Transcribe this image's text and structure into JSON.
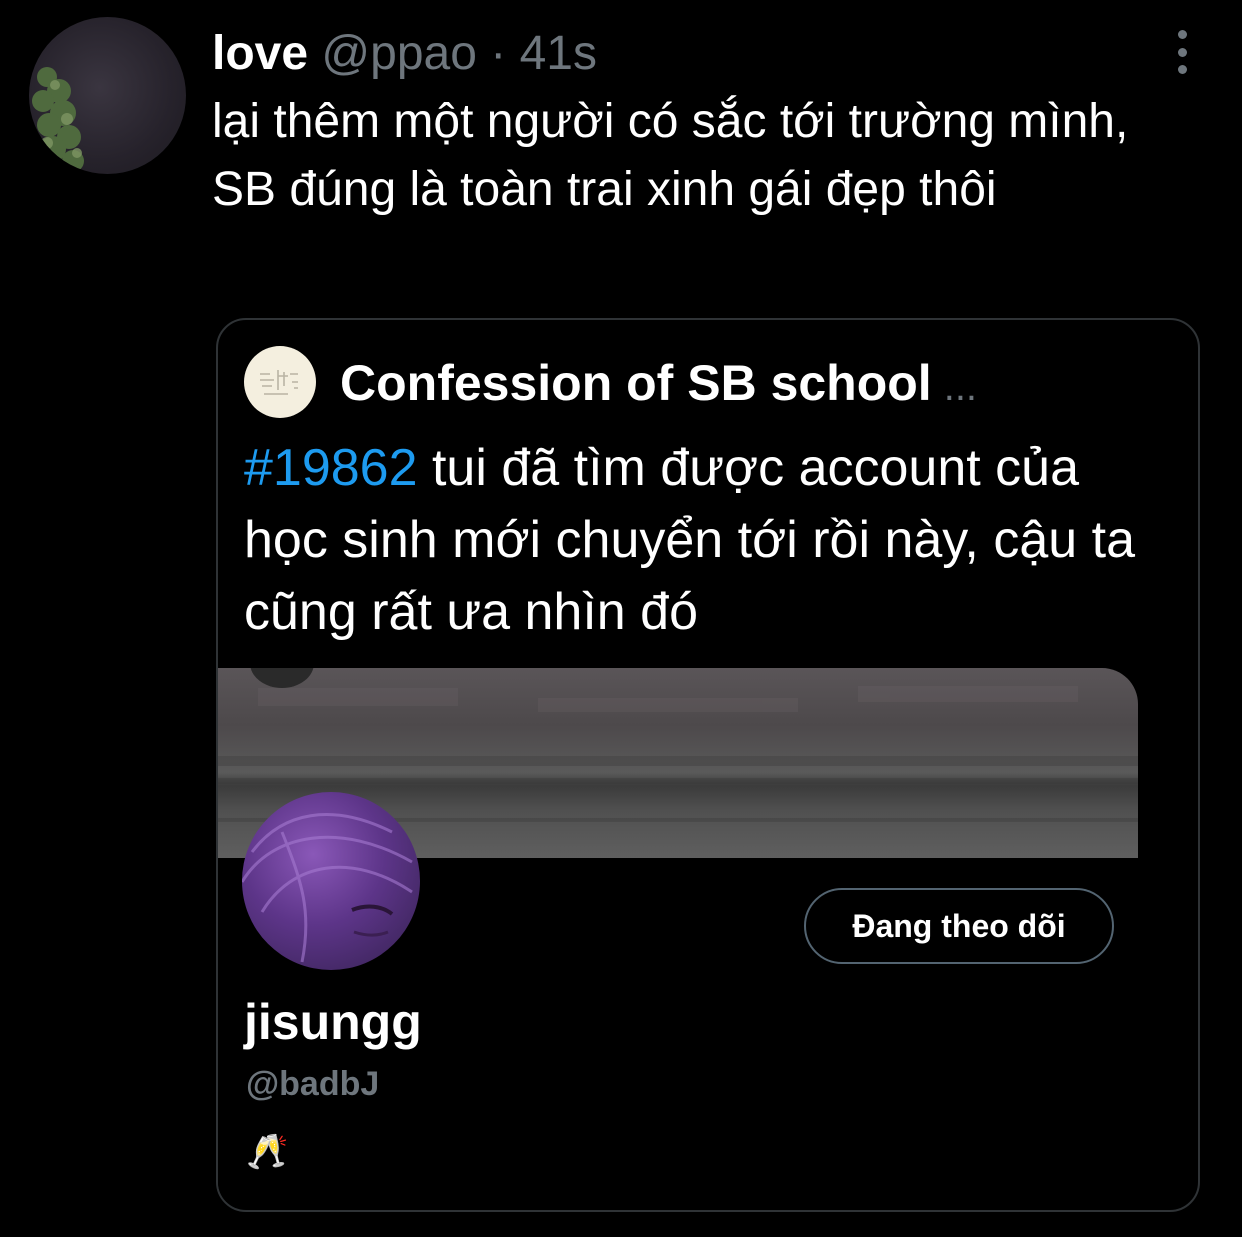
{
  "tweet": {
    "display_name": "love",
    "handle": "@ppao",
    "separator": "·",
    "time": "41s",
    "text": "lại thêm một người có sắc tới trường mình, SB đúng là toàn trai xinh gái đẹp thôi"
  },
  "icons": {
    "more": "more-vertical-icon",
    "avatar": "user-avatar"
  },
  "quote": {
    "author_name": "Confession of SB school",
    "author_ellipsis": "...",
    "hashtag": "#19862",
    "text": " tui đã tìm được account của học sinh mới chuyển tới rồi này, cậu ta cũng rất ưa nhìn đó"
  },
  "profile_card": {
    "name": "jisungg",
    "handle": "@badbJ",
    "bio": "🥂",
    "follow_label": "Đang theo dõi"
  },
  "colors": {
    "background": "#000000",
    "secondary_text": "#6e767d",
    "link": "#1d9bf0",
    "border": "#2f3336"
  }
}
